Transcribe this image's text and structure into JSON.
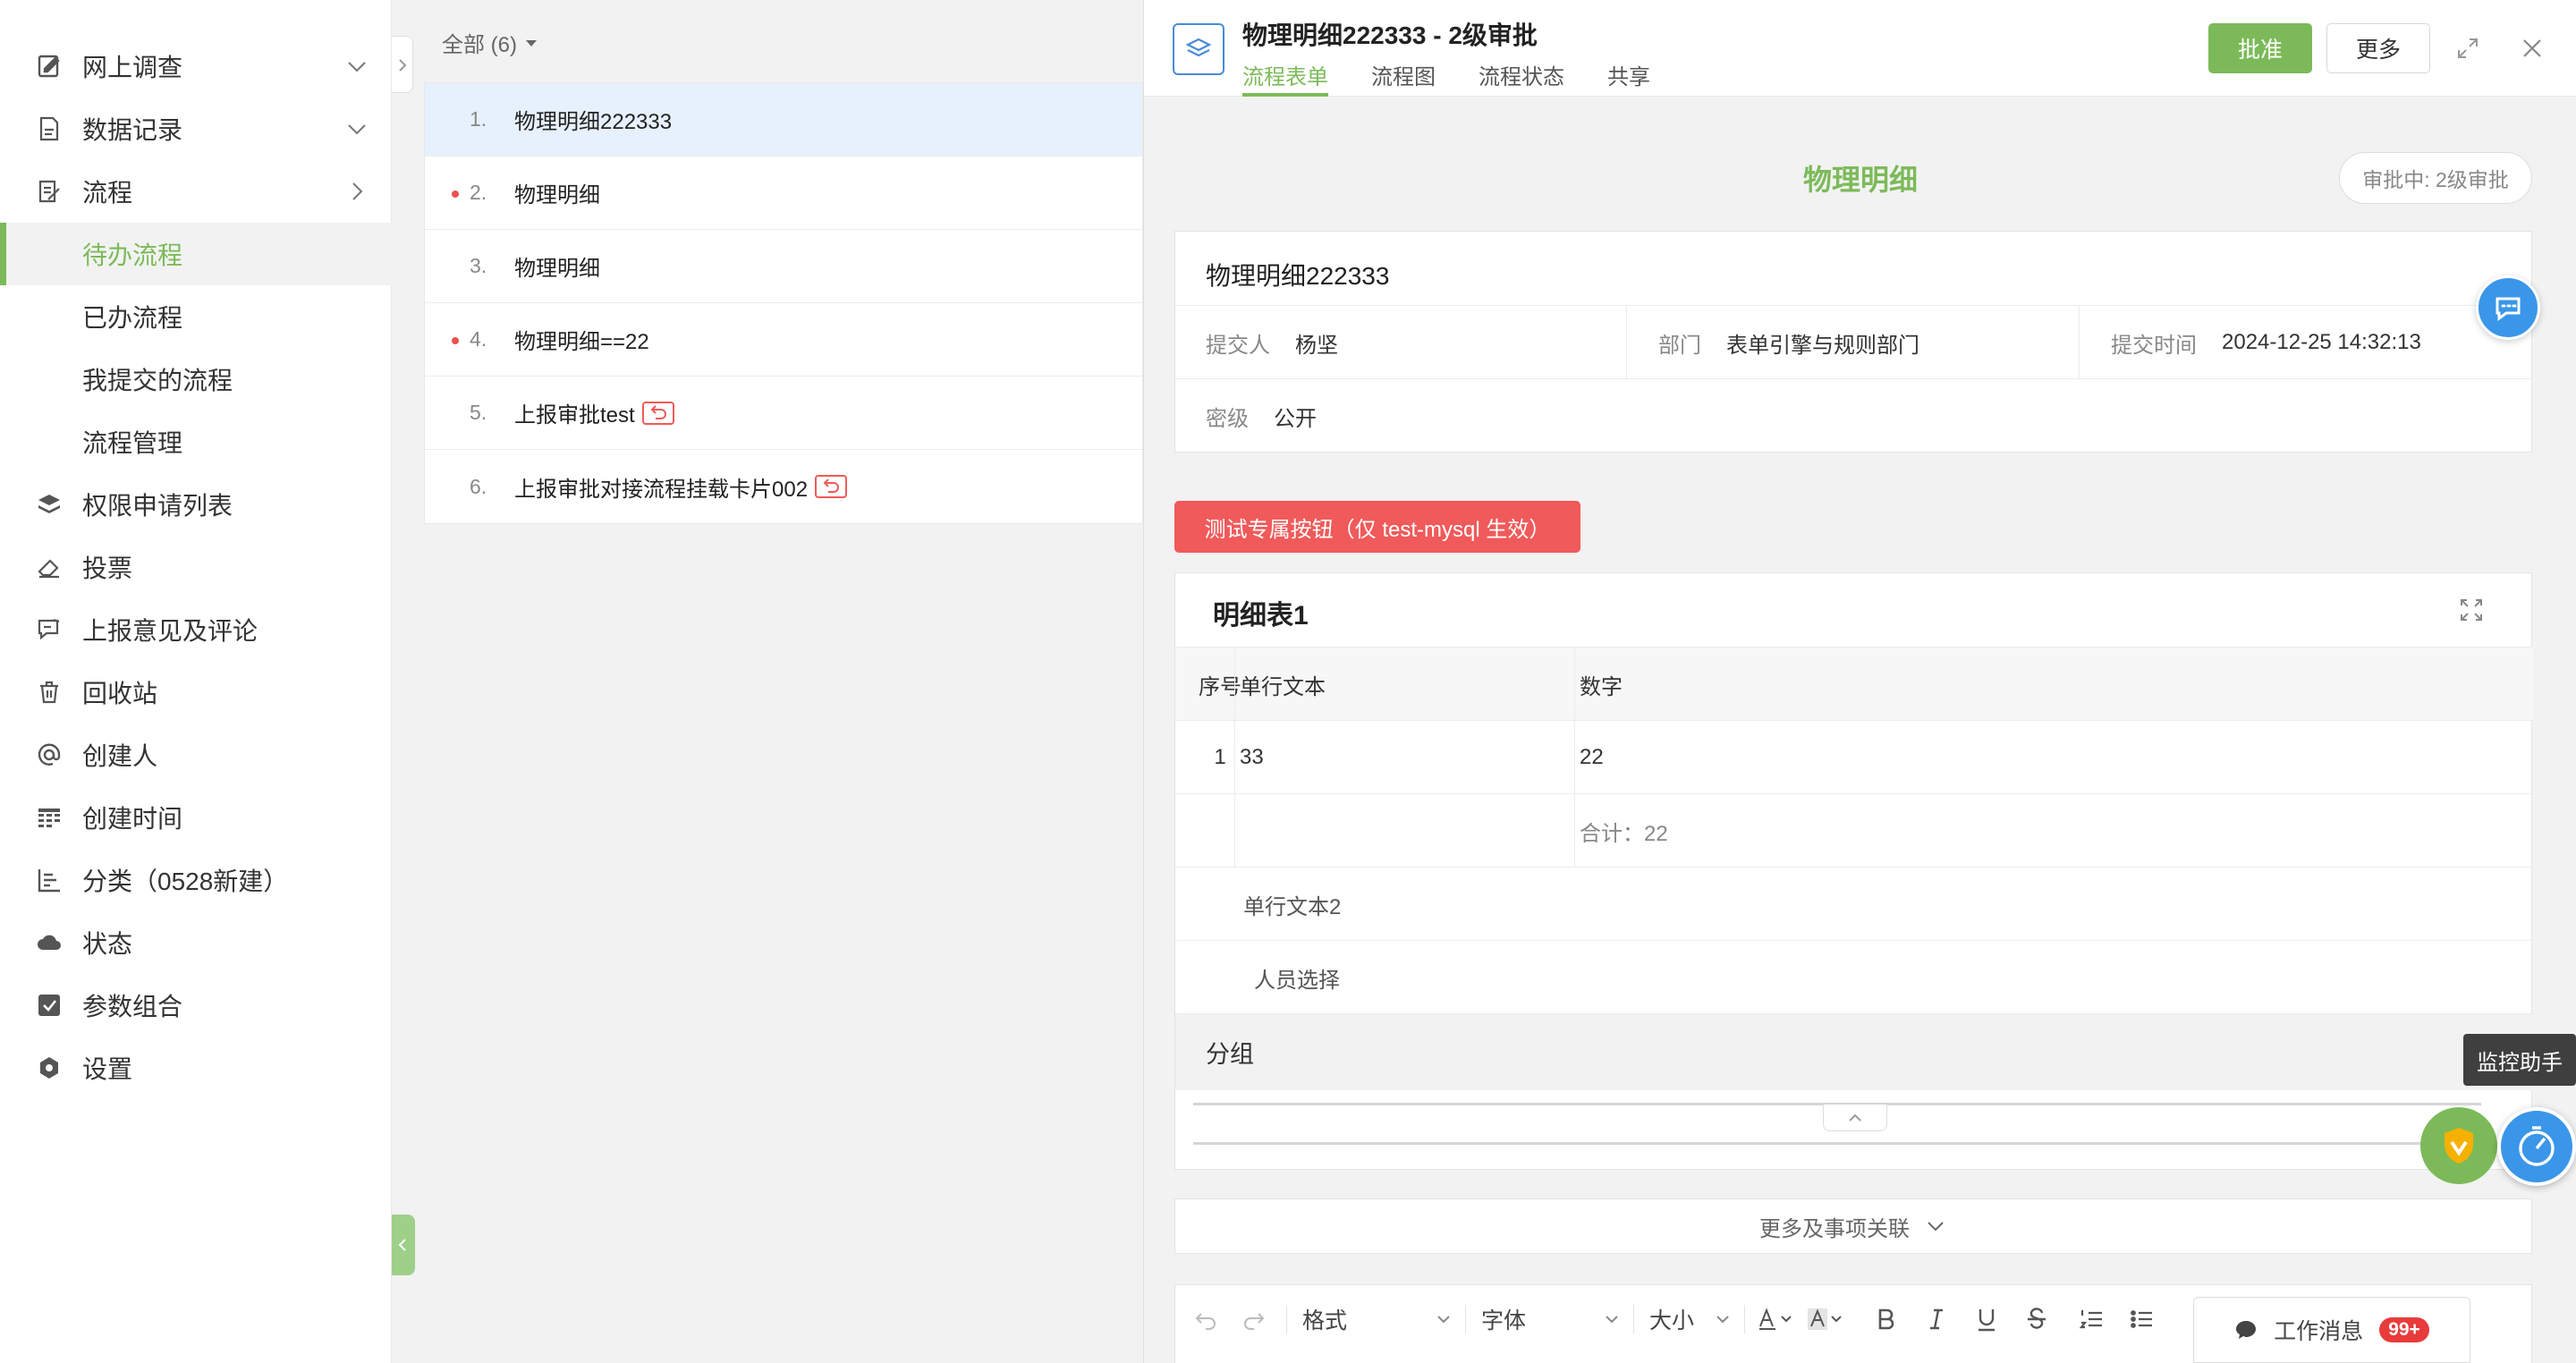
{
  "sidebar": {
    "items": [
      {
        "label": "网上调查",
        "icon": "survey-icon"
      },
      {
        "label": "数据记录",
        "icon": "records-icon"
      },
      {
        "label": "流程",
        "icon": "workflow-icon"
      },
      {
        "label": "待办流程"
      },
      {
        "label": "已办流程"
      },
      {
        "label": "我提交的流程"
      },
      {
        "label": "流程管理"
      },
      {
        "label": "权限申请列表",
        "icon": "layers-icon"
      },
      {
        "label": "投票",
        "icon": "eraser-icon"
      },
      {
        "label": "上报意见及评论",
        "icon": "comment-report-icon"
      },
      {
        "label": "回收站",
        "icon": "trash-icon"
      },
      {
        "label": "创建人",
        "icon": "at-icon"
      },
      {
        "label": "创建时间",
        "icon": "calendar-grid-icon"
      },
      {
        "label": "分类（0528新建）",
        "icon": "bar-list-icon"
      },
      {
        "label": "状态",
        "icon": "cloud-icon"
      },
      {
        "label": "参数组合",
        "icon": "checkbox-icon"
      },
      {
        "label": "设置",
        "icon": "gear-icon"
      }
    ],
    "accent": "#7cba59"
  },
  "list": {
    "filter": "全部 (6)",
    "rows": [
      {
        "num": "1.",
        "title": "物理明细222333"
      },
      {
        "num": "2.",
        "title": "物理明细"
      },
      {
        "num": "3.",
        "title": "物理明细"
      },
      {
        "num": "4.",
        "title": "物理明细==22"
      },
      {
        "num": "5.",
        "title": "上报审批test"
      },
      {
        "num": "6.",
        "title": "上报审批对接流程挂载卡片002"
      }
    ]
  },
  "detail": {
    "title": "物理明细222333 - 2级审批",
    "tabs": [
      "流程表单",
      "流程图",
      "流程状态",
      "共享"
    ],
    "approve": "批准",
    "more": "更多",
    "form_title": "物理明细",
    "status_badge": "审批中: 2级审批",
    "info": {
      "title": "物理明细222333",
      "submitter_label": "提交人",
      "submitter": "杨坚",
      "dept_label": "部门",
      "dept": "表单引擎与规则部门",
      "time_label": "提交时间",
      "time": "2024-12-25 14:32:13",
      "secret_label": "密级",
      "secret": "公开"
    },
    "test_button": "测试专属按钮（仅 test-mysql 生效）",
    "detail_table": {
      "name": "明细表1",
      "headers": [
        "序号",
        "单行文本",
        "数字"
      ],
      "rows": [
        [
          "1",
          "33",
          "22"
        ]
      ],
      "total": "合计：22"
    },
    "fields": [
      "单行文本2",
      "人员选择"
    ],
    "group": "分组",
    "more_bar": "更多及事项关联",
    "editor": {
      "format": "格式",
      "font": "字体",
      "size": "大小"
    }
  },
  "floating": {
    "work_msg": "工作消息",
    "badge": "99+",
    "monitor": "监控助手"
  }
}
